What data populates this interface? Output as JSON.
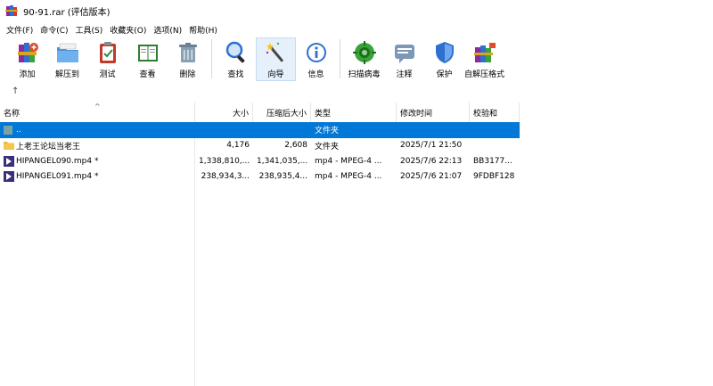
{
  "window": {
    "title": "90-91.rar (评估版本)",
    "icon": "winrar-books-icon"
  },
  "menu": [
    {
      "label": "文件(F)"
    },
    {
      "label": "命令(C)"
    },
    {
      "label": "工具(S)"
    },
    {
      "label": "收藏夹(O)"
    },
    {
      "label": "选项(N)"
    },
    {
      "label": "帮助(H)"
    }
  ],
  "toolbar": [
    {
      "label": "添加",
      "icon": "add-archive-icon"
    },
    {
      "label": "解压到",
      "icon": "extract-folder-icon"
    },
    {
      "label": "测试",
      "icon": "test-clipboard-icon"
    },
    {
      "label": "查看",
      "icon": "view-book-icon"
    },
    {
      "label": "删除",
      "icon": "trash-bin-icon"
    },
    {
      "label": "查找",
      "icon": "magnifier-icon"
    },
    {
      "label": "向导",
      "icon": "magic-wand-icon"
    },
    {
      "label": "信息",
      "icon": "info-icon"
    },
    {
      "label": "扫描病毒",
      "icon": "virus-scan-icon"
    },
    {
      "label": "注释",
      "icon": "comment-icon"
    },
    {
      "label": "保护",
      "icon": "shield-icon"
    },
    {
      "label": "自解压格式",
      "icon": "sfx-archive-icon"
    }
  ],
  "pathbar": {
    "up_glyph": "↑"
  },
  "columns": {
    "name": "名称",
    "size": "大小",
    "packed": "压缩后大小",
    "type": "类型",
    "modified": "修改时间",
    "crc": "校验和",
    "sort_glyph": "^"
  },
  "rows": [
    {
      "name": "..",
      "size": "",
      "packed": "",
      "type": "文件夹",
      "modified": "",
      "crc": "",
      "icon": "parent-folder-icon",
      "selected": true
    },
    {
      "name": "上老王论坛当老王",
      "size": "4,176",
      "packed": "2,608",
      "type": "文件夹",
      "modified": "2025/7/1 21:50",
      "crc": "",
      "icon": "folder-icon",
      "selected": false
    },
    {
      "name": "HIPANGEL090.mp4 *",
      "size": "1,338,810,...",
      "packed": "1,341,035,...",
      "type": "mp4 - MPEG-4 ...",
      "modified": "2025/7/6 22:13",
      "crc": "BB3177...",
      "icon": "mp4-file-icon",
      "selected": false
    },
    {
      "name": "HIPANGEL091.mp4 *",
      "size": "238,934,3...",
      "packed": "238,935,4...",
      "type": "mp4 - MPEG-4 ...",
      "modified": "2025/7/6 21:07",
      "crc": "9FDBF128",
      "icon": "mp4-file-icon",
      "selected": false
    }
  ],
  "colors": {
    "selection": "#0078d7",
    "folder": "#f4c84c",
    "wizard_highlight": "#e6f0fa"
  }
}
